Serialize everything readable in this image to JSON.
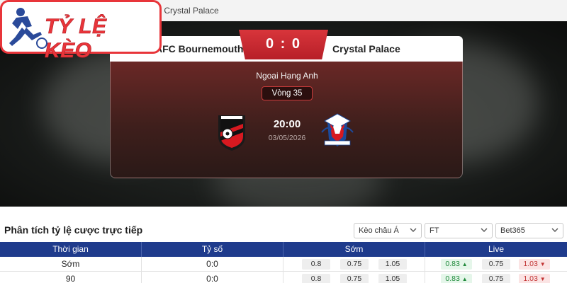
{
  "breadcrumb": "s Crystal Palace",
  "logo": {
    "text": "TỶ LỆ KÈO"
  },
  "match": {
    "home_team": "AFC Bournemouth",
    "away_team": "Crystal Palace",
    "score": "0 : 0",
    "league": "Ngoại Hạng Anh",
    "round": "Vòng 35",
    "time": "20:00",
    "date": "03/05/2026",
    "home_crest_icon": "bournemouth-crest-icon",
    "away_crest_icon": "crystal-palace-crest-icon"
  },
  "odds_section": {
    "title": "Phân tích tỷ lệ cược trực tiếp",
    "filters": [
      {
        "value": "Kèo châu Á"
      },
      {
        "value": "FT"
      },
      {
        "value": "Bet365"
      }
    ],
    "columns": [
      "Thời gian",
      "Tỷ số",
      "Sớm",
      "Live"
    ],
    "rows": [
      {
        "time": "Sớm",
        "score": "0:0",
        "early": [
          "0.8",
          "0.75",
          "1.05"
        ],
        "live": [
          "0.83",
          "0.75",
          "1.03"
        ]
      },
      {
        "time": "90",
        "score": "0:0",
        "early": [
          "0.8",
          "0.75",
          "1.05"
        ],
        "live": [
          "0.83",
          "0.75",
          "1.03"
        ]
      }
    ]
  },
  "colors": {
    "accent": "#e8353a",
    "table_header": "#1f3b8c",
    "up": "#218a3c",
    "down": "#c23434"
  }
}
